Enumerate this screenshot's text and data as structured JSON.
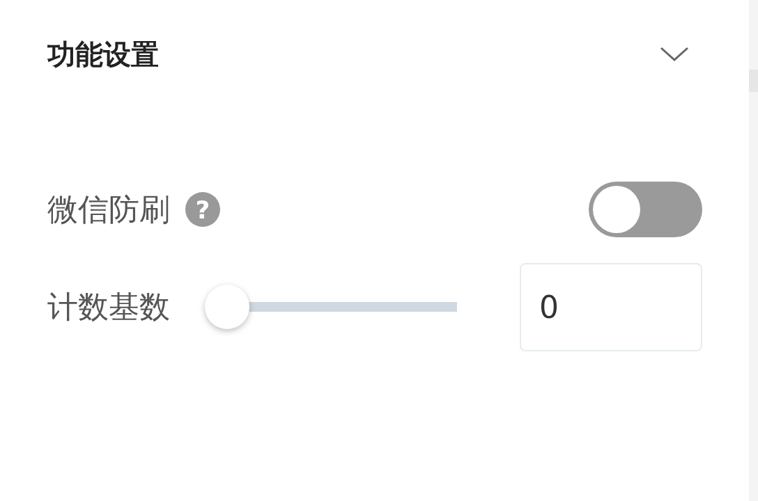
{
  "section": {
    "title": "功能设置",
    "expanded": true
  },
  "settings": [
    {
      "kind": "toggle",
      "label": "微信防刷",
      "help_icon": "?",
      "on": false
    },
    {
      "kind": "slider",
      "label": "计数基数",
      "level": 0,
      "value": "0"
    }
  ]
}
